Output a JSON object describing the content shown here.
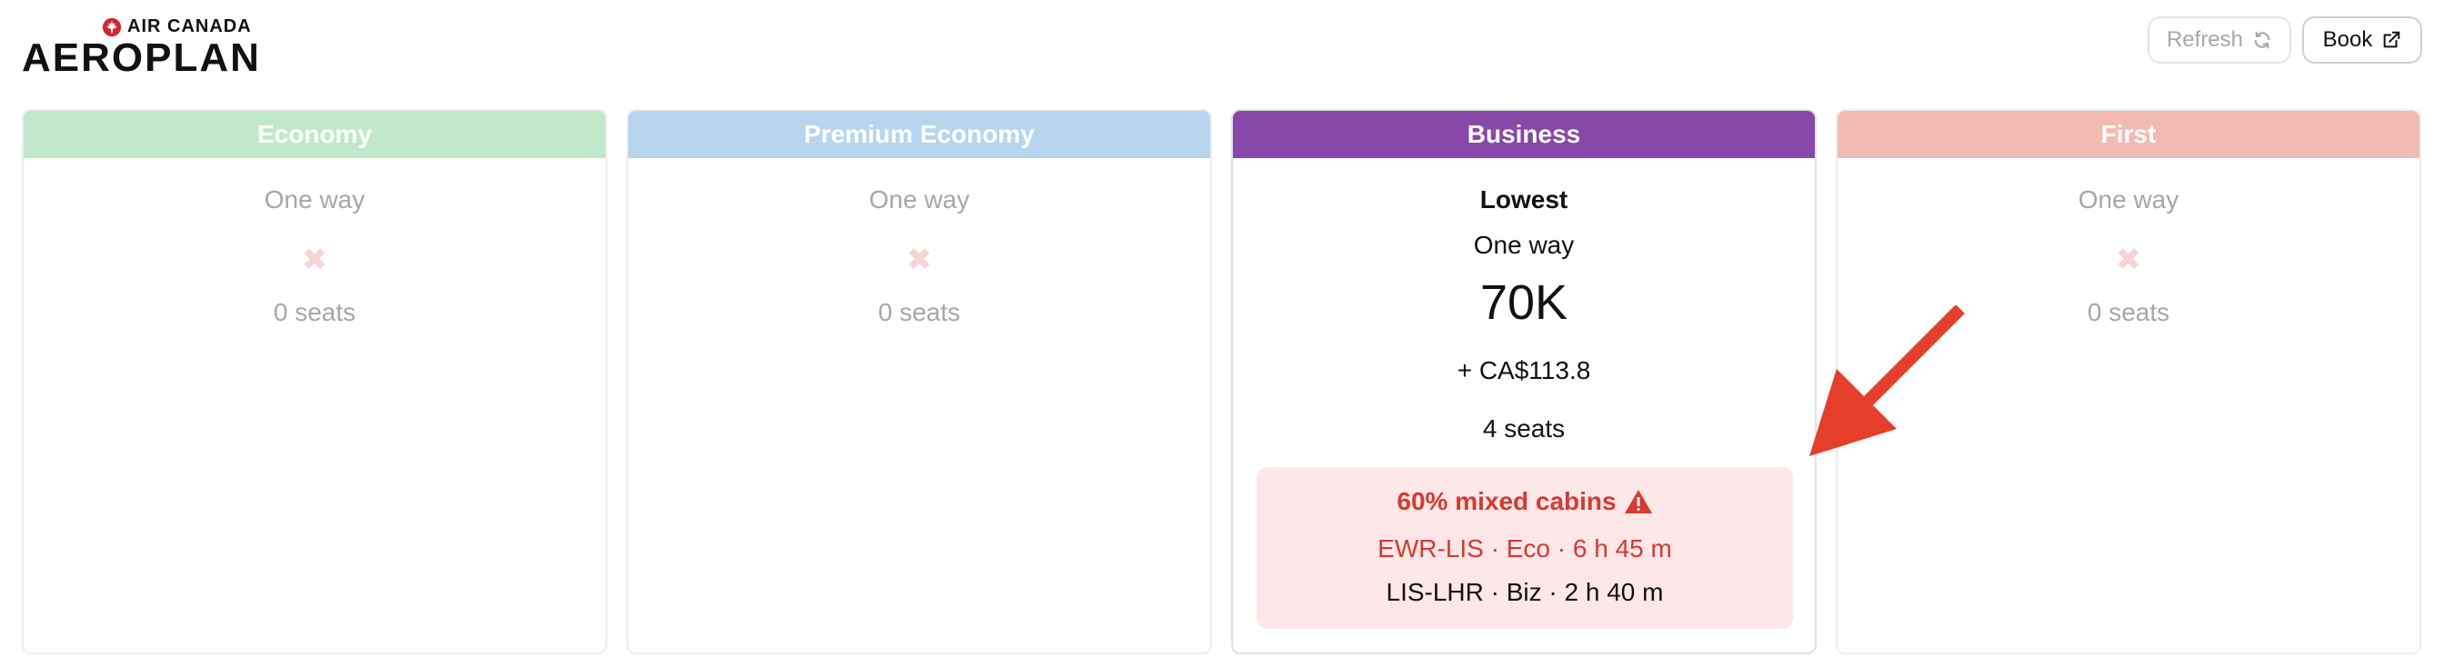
{
  "brand": {
    "small_text": "AIR CANADA",
    "big_text": "AEROPLAN"
  },
  "toolbar": {
    "refresh_label": "Refresh",
    "book_label": "Book"
  },
  "cabins": [
    {
      "header": "Economy",
      "one_way": "One way",
      "unavailable_mark": "✖",
      "seats": "0 seats",
      "header_color": "#c2e8cc"
    },
    {
      "header": "Premium Economy",
      "one_way": "One way",
      "unavailable_mark": "✖",
      "seats": "0 seats",
      "header_color": "#b7d5ee"
    },
    {
      "header": "Business",
      "lowest": "Lowest",
      "one_way": "One way",
      "miles": "70K",
      "cash": "+ CA$113.8",
      "seats": "4 seats",
      "header_color": "#8748aa",
      "mixed": {
        "title": "60% mixed cabins",
        "segment1": "EWR-LIS · Eco · 6 h 45 m",
        "segment2": "LIS-LHR · Biz · 2 h 40 m"
      }
    },
    {
      "header": "First",
      "one_way": "One way",
      "unavailable_mark": "✖",
      "seats": "0 seats",
      "header_color": "#f1bbb3"
    }
  ],
  "colors": {
    "warning_text": "#d63a2f",
    "warning_bg": "#fde7e8",
    "annotation_arrow": "#e53e2b"
  },
  "icons": [
    "maple-leaf-icon",
    "refresh-icon",
    "external-link-icon",
    "warning-icon",
    "close-icon",
    "arrow-icon"
  ]
}
